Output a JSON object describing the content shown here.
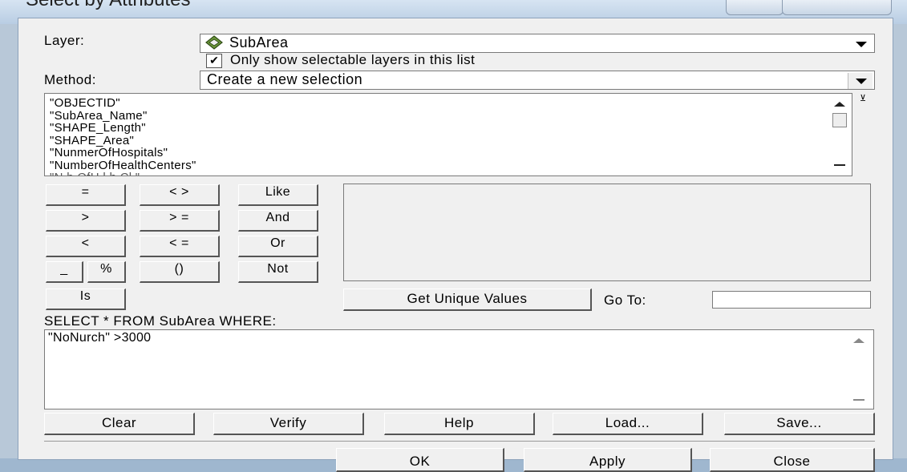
{
  "window": {
    "title": "Select by Attributes"
  },
  "layer": {
    "label": "Layer:",
    "value": "SubArea",
    "only_selectable_label": "Only show selectable layers in this list",
    "only_selectable_checked": true
  },
  "method": {
    "label": "Method:",
    "value": "Create a new selection"
  },
  "fields": [
    "\"OBJECTID\"",
    "\"SubArea_Name\"",
    "\"SHAPE_Length\"",
    "\"SHAPE_Area\"",
    "\"NunmerOfHospitals\"",
    "\"NumberOfHealthCenters\""
  ],
  "operators": {
    "eq": "=",
    "ne": "< >",
    "like": "Like",
    "gt": ">",
    "ge": "> =",
    "and": "And",
    "lt": "<",
    "le": "< =",
    "or": "Or",
    "underscore": "_",
    "percent": "%",
    "parens": "()",
    "not": "Not",
    "is": "Is"
  },
  "get_unique_values": "Get Unique Values",
  "goto_label": "Go To:",
  "goto_value": "",
  "sql_prefix": "SELECT * FROM SubArea WHERE:",
  "expression": "\"NoNurch\" >3000",
  "actions": {
    "clear": "Clear",
    "verify": "Verify",
    "help": "Help",
    "load": "Load...",
    "save": "Save..."
  },
  "footer": {
    "ok": "OK",
    "apply": "Apply",
    "close": "Close"
  }
}
